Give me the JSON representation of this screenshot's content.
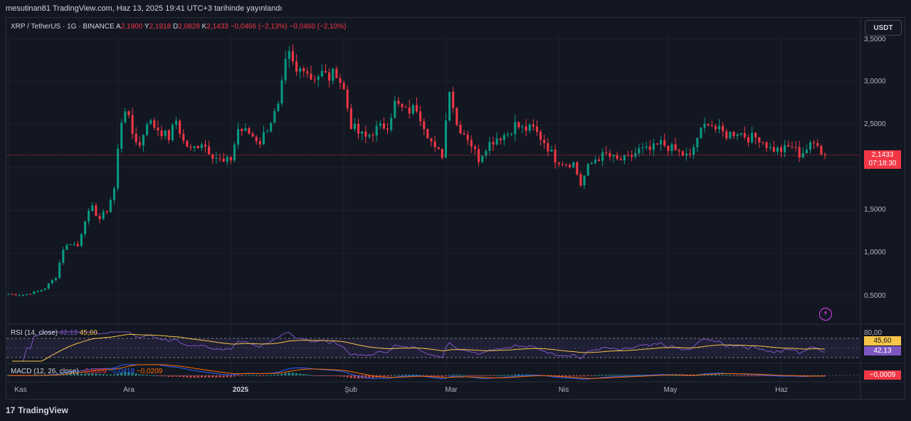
{
  "header": {
    "published_line": "mesutinan81 TradingView.com, Haz 13, 2025 19:41 UTC+3 tarihinde yayınlandı"
  },
  "legend": {
    "symbol": "XRP / TetherUS · 1G · BINANCE",
    "open_key": "A",
    "open": "2,1900",
    "high_key": "Y",
    "high": "2,1918",
    "low_key": "D",
    "low": "2,0828",
    "close_key": "K",
    "close": "2,1433",
    "change": "−0,0466 (−2,13%)",
    "change2": "−0,0460 (−2,10%)"
  },
  "currency_button": "USDT",
  "price_axis": [
    "3,5000",
    "3,0000",
    "2,5000",
    "2,0000",
    "1,5000",
    "1,0000",
    "0,5000"
  ],
  "price_badge": {
    "price": "2,1433",
    "countdown": "07:18:30"
  },
  "rsi": {
    "label": "RSI (14, close)",
    "value1": "42,13",
    "value2": "45,60",
    "axis_top": "80,00",
    "badge_ma": "45,60",
    "badge_rsi": "42,13"
  },
  "macd": {
    "label": "MACD (12, 26, close)",
    "v1": "−0,0009",
    "v2": "−0,0418",
    "v3": "−0,0209",
    "badge": "−0,0009"
  },
  "x_axis": [
    "Kas",
    "Ara",
    "2025",
    "Şub",
    "Mar",
    "Nis",
    "May",
    "Haz"
  ],
  "footer": {
    "brand": "TradingView"
  },
  "colors": {
    "up": "#089981",
    "down": "#f23645",
    "rsi": "#7e57c2",
    "rsi_ma": "#f7c548",
    "macd": "#2962ff",
    "signal": "#ff6d00"
  },
  "chart_data": {
    "type": "candlestick",
    "symbol": "XRP/USDT",
    "timeframe": "1D",
    "ylim": [
      0.25,
      3.55
    ],
    "y_scale": "linear",
    "grid": true,
    "last_price": 2.1433,
    "series": [
      {
        "type": "close_path",
        "points": [
          [
            "2024-11-01",
            0.52
          ],
          [
            "2024-11-05",
            0.51
          ],
          [
            "2024-11-09",
            0.55
          ],
          [
            "2024-11-11",
            0.59
          ],
          [
            "2024-11-14",
            0.72
          ],
          [
            "2024-11-16",
            1.05
          ],
          [
            "2024-11-18",
            1.12
          ],
          [
            "2024-11-20",
            1.08
          ],
          [
            "2024-11-22",
            1.4
          ],
          [
            "2024-11-24",
            1.52
          ],
          [
            "2024-11-26",
            1.4
          ],
          [
            "2024-11-28",
            1.5
          ],
          [
            "2024-11-30",
            1.75
          ],
          [
            "2024-12-01",
            2.2
          ],
          [
            "2024-12-02",
            2.55
          ],
          [
            "2024-12-03",
            2.7
          ],
          [
            "2024-12-05",
            2.4
          ],
          [
            "2024-12-07",
            2.25
          ],
          [
            "2024-12-09",
            2.55
          ],
          [
            "2024-12-12",
            2.45
          ],
          [
            "2024-12-15",
            2.35
          ],
          [
            "2024-12-17",
            2.55
          ],
          [
            "2024-12-19",
            2.3
          ],
          [
            "2024-12-21",
            2.2
          ],
          [
            "2024-12-24",
            2.3
          ],
          [
            "2024-12-27",
            2.15
          ],
          [
            "2024-12-30",
            2.05
          ],
          [
            "2025-01-01",
            2.1
          ],
          [
            "2025-01-03",
            2.45
          ],
          [
            "2025-01-06",
            2.4
          ],
          [
            "2025-01-09",
            2.3
          ],
          [
            "2025-01-12",
            2.55
          ],
          [
            "2025-01-14",
            2.7
          ],
          [
            "2025-01-16",
            3.2
          ],
          [
            "2025-01-17",
            3.3
          ],
          [
            "2025-01-19",
            3.1
          ],
          [
            "2025-01-21",
            3.2
          ],
          [
            "2025-01-23",
            3.05
          ],
          [
            "2025-01-26",
            3.1
          ],
          [
            "2025-01-28",
            3.05
          ],
          [
            "2025-01-30",
            3.12
          ],
          [
            "2025-02-01",
            2.9
          ],
          [
            "2025-02-03",
            2.5
          ],
          [
            "2025-02-05",
            2.4
          ],
          [
            "2025-02-07",
            2.35
          ],
          [
            "2025-02-10",
            2.45
          ],
          [
            "2025-02-13",
            2.5
          ],
          [
            "2025-02-15",
            2.75
          ],
          [
            "2025-02-18",
            2.65
          ],
          [
            "2025-02-21",
            2.7
          ],
          [
            "2025-02-23",
            2.5
          ],
          [
            "2025-02-26",
            2.2
          ],
          [
            "2025-02-28",
            2.15
          ],
          [
            "2025-03-02",
            2.95
          ],
          [
            "2025-03-04",
            2.5
          ],
          [
            "2025-03-07",
            2.35
          ],
          [
            "2025-03-10",
            2.1
          ],
          [
            "2025-03-12",
            2.25
          ],
          [
            "2025-03-15",
            2.35
          ],
          [
            "2025-03-18",
            2.4
          ],
          [
            "2025-03-20",
            2.5
          ],
          [
            "2025-03-22",
            2.45
          ],
          [
            "2025-03-25",
            2.45
          ],
          [
            "2025-03-28",
            2.3
          ],
          [
            "2025-03-31",
            2.1
          ],
          [
            "2025-04-03",
            2.05
          ],
          [
            "2025-04-05",
            2.05
          ],
          [
            "2025-04-07",
            1.8
          ],
          [
            "2025-04-09",
            2.0
          ],
          [
            "2025-04-11",
            2.1
          ],
          [
            "2025-04-14",
            2.15
          ],
          [
            "2025-04-17",
            2.08
          ],
          [
            "2025-04-20",
            2.1
          ],
          [
            "2025-04-23",
            2.2
          ],
          [
            "2025-04-26",
            2.2
          ],
          [
            "2025-04-29",
            2.28
          ],
          [
            "2025-05-02",
            2.22
          ],
          [
            "2025-05-05",
            2.15
          ],
          [
            "2025-05-07",
            2.12
          ],
          [
            "2025-05-09",
            2.35
          ],
          [
            "2025-05-12",
            2.55
          ],
          [
            "2025-05-14",
            2.45
          ],
          [
            "2025-05-17",
            2.38
          ],
          [
            "2025-05-20",
            2.42
          ],
          [
            "2025-05-23",
            2.35
          ],
          [
            "2025-05-26",
            2.35
          ],
          [
            "2025-05-29",
            2.22
          ],
          [
            "2025-06-01",
            2.2
          ],
          [
            "2025-06-04",
            2.25
          ],
          [
            "2025-06-06",
            2.15
          ],
          [
            "2025-06-09",
            2.25
          ],
          [
            "2025-06-11",
            2.3
          ],
          [
            "2025-06-12",
            2.19
          ],
          [
            "2025-06-13",
            2.14
          ]
        ]
      },
      {
        "name": "RSI (14, close)",
        "last": 42.13
      },
      {
        "name": "RSI MA",
        "last": 45.6
      },
      {
        "name": "MACD (12, 26, close)",
        "last": -0.0009
      }
    ]
  }
}
